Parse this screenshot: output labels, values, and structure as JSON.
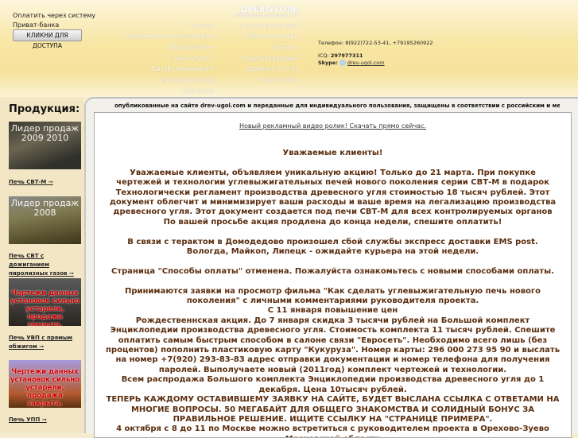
{
  "header": {
    "pay_text": [
      "Оплатить через систему",
      "Приват-банка"
    ],
    "pay_button": "КЛИКНИ ДЛЯ ДОСТУПА",
    "logo_title": "ДРЕВ-УГОЛЬ",
    "logo_subtitle": "производство древесного угля",
    "nav_left": [
      "Главная",
      "Содержание энциклопедии",
      "Оборудование",
      "Как купить?",
      "Вызов специалиста",
      "Страница позора",
      "Контакты"
    ],
    "nav_right": [
      "Страница примера",
      "Новости и акции",
      "Скачать",
      "Покупка/продажа",
      "древесного угля",
      "Карта сайта"
    ],
    "phone_label": "Телефон:",
    "phone": "8(922)722-53-41, +79195260922",
    "icq_label": "ICQ:",
    "icq": "297977311",
    "skype_label": "Skype:",
    "skype": "drev-ugol.com"
  },
  "sidebar": {
    "title": "Продукция:",
    "products": [
      {
        "image_text": "Лидер продаж 2009 2010",
        "link": "Печь СВТ-М ➞"
      },
      {
        "image_text": "Лидер продаж 2008",
        "link": "Печь СВТ с дожиганием пиролизных газов ➞"
      },
      {
        "image_text": "Чертежи данных установок сильно устарели, продажа закрыта.",
        "link": "Печь УВП с прямым обжигом ➞"
      },
      {
        "image_text": "Чертежи данных установок сильно устарели, продажа закрыта.",
        "link": "Печь УПП ➞"
      }
    ]
  },
  "main": {
    "ticker": "опубликованные на сайте drev-ugol.com и переданные для индивидуального пользования, защищены в соответствии с российским и международным",
    "video_link": "Новый рекламный видео ролик! Скачать прямо сейчас.",
    "greeting": "Уважаемые клиенты!",
    "p1": "Уважаемые клиенты, объявляем уникальную акцию! Только до 21 марта. При покупке чертежей и технологии углевыжигательных печей нового поколения серии СВТ-М в подарок Технологически регламент производства древесного угля стоимостью 18 тысяч рублей. Этот документ облегчит и минимизирует ваши расходы и ваше время на легализацию производства древесного угля. Этот документ создается под печи СВТ-М для всех контролируемых органов",
    "p1b": "По вашей просьбе акция продлена до конца недели, спешите оплатить!",
    "p2": "В связи с терактом в Домодедово произошел сбой службы экспресс доставки EMS post. Вологда, Майкоп, Липецк - ожидайте курьера на этой недели.",
    "p3": "Страница \"Способы оплаты\" отменена. Пожалуйста ознакомьтесь с новыми способами оплаты.",
    "p4": "Принимаются заявки на просмотр фильма \"Как сделать углевыжигательную печь нового поколения\" с личными комментариями руководителя проекта.",
    "p5": "С 11 января повышение цен",
    "p6": "Рождественнская акция. До 7 января скидка 3 тысячи рублей на Большой комплект Энциклопедии производства древесного угля. Стоимость комплекта 11 тысяч рублей. Спешите оплатить самым быстрым способом в салоне связи \"Евросеть\". Необходимо всего лишь (без процентов) пополнить пластиковую карту \"Кукуруза\". Номер карты: 296 000 273 95 90 и выслать на номер +7(920) 293-83-83 адрес отправки документации и номер телефона для получения паролей. Выполучаете новый (2011год) комплект чертежей и технологии.",
    "p7": "Всем распродажа Большого комплекта Энциклопедии производства древесного угля до 1 декабря. Цена 10тысяч рублей.",
    "p8": "ТЕПЕРЬ КАЖДОМУ ОСТАВИВШЕМУ ЗАЯВКУ НА САЙТЕ, БУДЕТ ВЫСЛАНА ССЫЛКА С ОТВЕТАМИ НА МНОГИЕ ВОПРОСЫ. 50 МЕГАБАЙТ ДЛЯ ОБЩЕГО ЗНАКОМСТВА И СОЛИДНЫЙ БОНУС ЗА ПРАВИЛЬНОЕ РЕШЕНИЕ. ИЩИТЕ ССЫЛКУ НА \"СТРАНИЦЕ ПРИМЕРА\".",
    "p9": "4 октября с 8 до 11 по Москве можно встретиться с руководителем проекта в Орехово-Зуево Московской области"
  }
}
